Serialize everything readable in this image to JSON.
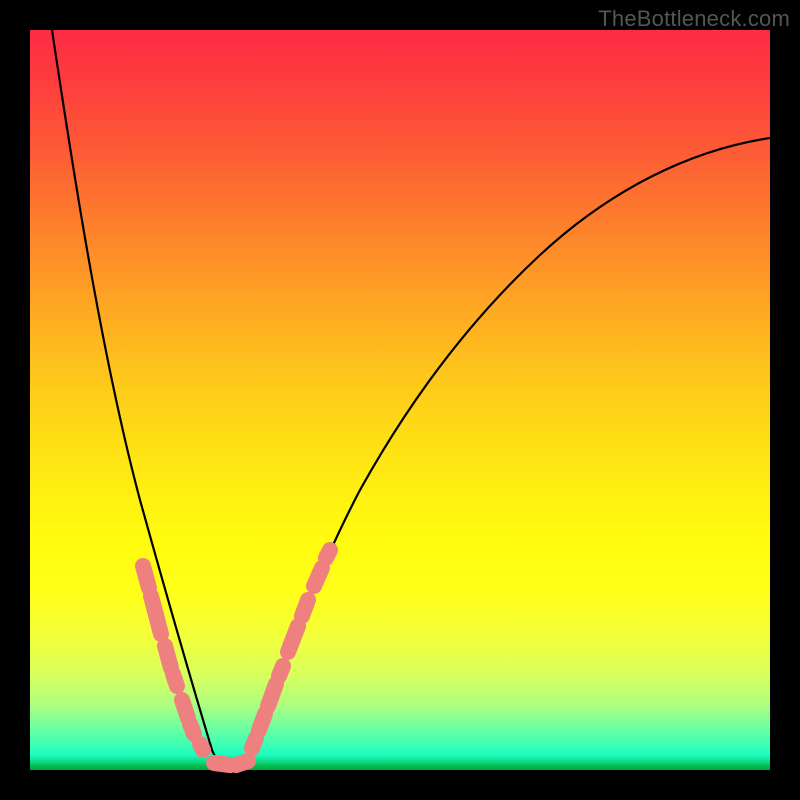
{
  "watermark": "TheBottleneck.com",
  "colors": {
    "bead": "#ef8080",
    "curve": "#000000",
    "frame": "#000000"
  },
  "chart_data": {
    "type": "line",
    "title": "",
    "xlabel": "",
    "ylabel": "",
    "xlim": [
      0,
      100
    ],
    "ylim": [
      0,
      100
    ],
    "grid": false,
    "legend": false,
    "description": "V-shaped bottleneck curve on rainbow gradient background. Y encodes bottleneck severity (top=red/high, bottom=green/low). Minimum near x≈25.",
    "series": [
      {
        "name": "bottleneck_curve",
        "x": [
          3,
          5,
          7,
          9,
          11,
          13,
          15,
          17,
          19,
          21,
          23,
          25,
          27,
          29,
          31,
          33,
          35,
          37,
          40,
          44,
          48,
          52,
          57,
          62,
          68,
          75,
          82,
          90,
          100
        ],
        "y": [
          100,
          93,
          85,
          77,
          68,
          59,
          50,
          41,
          32,
          23,
          14,
          4,
          1,
          1,
          5,
          12,
          20,
          27,
          34,
          42,
          49,
          55,
          61,
          66,
          71,
          75,
          79,
          82,
          85
        ],
        "note": "y is approximate percent height read from gradient background; minimum (balanced point) at roughly x=26, y≈0"
      }
    ],
    "beads": {
      "note": "salmon capsule markers clustered along the lower part of the V",
      "left_arm": [
        {
          "x": 15.5,
          "y": 26
        },
        {
          "x": 16.5,
          "y": 23
        },
        {
          "x": 18.5,
          "y": 18
        },
        {
          "x": 19.5,
          "y": 15.5
        },
        {
          "x": 20.5,
          "y": 13
        },
        {
          "x": 22.0,
          "y": 9
        },
        {
          "x": 22.8,
          "y": 7
        },
        {
          "x": 24.0,
          "y": 4
        }
      ],
      "bottom": [
        {
          "x": 25.5,
          "y": 1
        },
        {
          "x": 27.5,
          "y": 1
        }
      ],
      "right_arm": [
        {
          "x": 29.0,
          "y": 5
        },
        {
          "x": 30.0,
          "y": 8
        },
        {
          "x": 31.0,
          "y": 11
        },
        {
          "x": 31.8,
          "y": 14
        },
        {
          "x": 33.0,
          "y": 18
        },
        {
          "x": 34.0,
          "y": 21
        },
        {
          "x": 35.5,
          "y": 25
        },
        {
          "x": 36.5,
          "y": 28
        }
      ]
    }
  }
}
